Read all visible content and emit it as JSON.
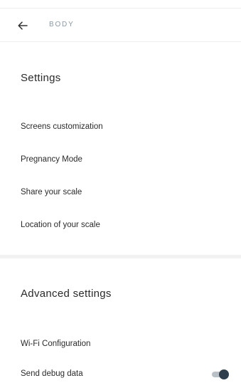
{
  "header": {
    "title": "BODY"
  },
  "settings": {
    "title": "Settings",
    "items": [
      {
        "label": "Screens customization"
      },
      {
        "label": "Pregnancy Mode"
      },
      {
        "label": "Share your scale"
      },
      {
        "label": "Location of your scale"
      }
    ]
  },
  "advanced": {
    "title": "Advanced settings",
    "items": [
      {
        "label": "Wi-Fi Configuration"
      },
      {
        "label": "Send debug data",
        "toggle_on": true
      }
    ]
  },
  "colors": {
    "toggle_thumb": "#2e3e4c",
    "toggle_track": "#b9c1c7",
    "header_title": "#8a9aa3"
  }
}
